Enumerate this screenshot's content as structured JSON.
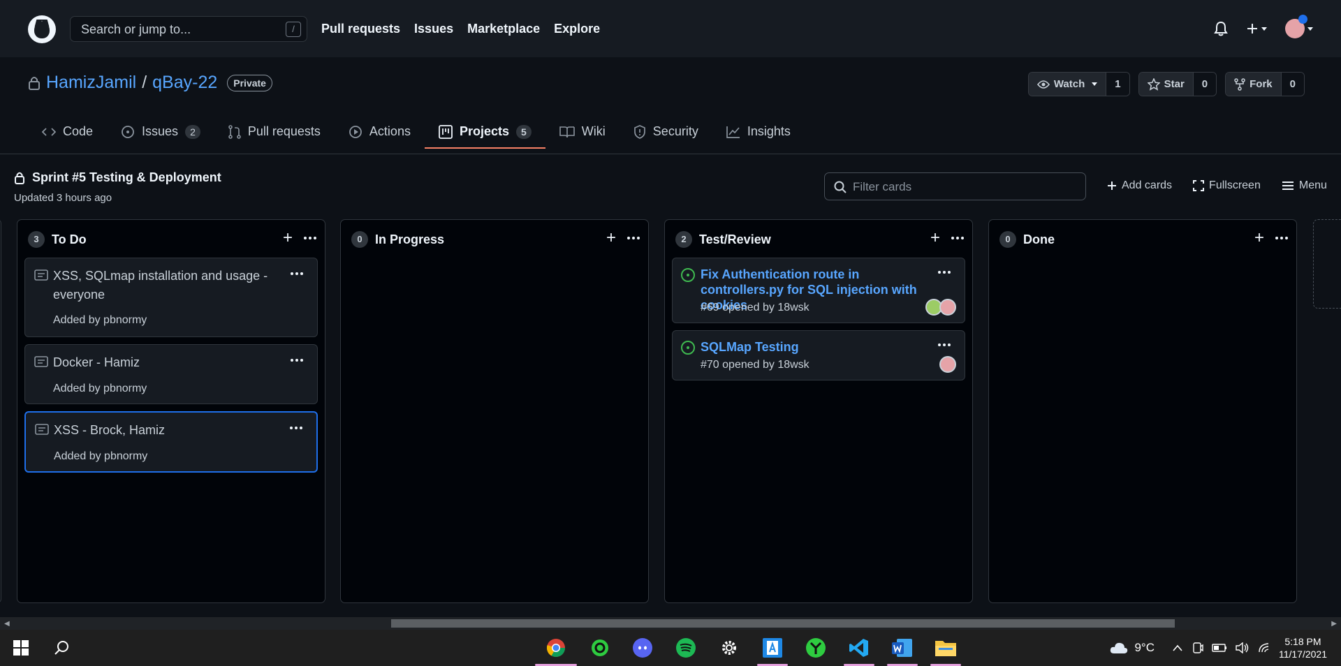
{
  "header": {
    "search_placeholder": "Search or jump to...",
    "search_shortcut": "/",
    "nav": [
      "Pull requests",
      "Issues",
      "Marketplace",
      "Explore"
    ]
  },
  "repo": {
    "owner": "HamizJamil",
    "separator": "/",
    "name": "qBay-22",
    "visibility": "Private",
    "watch_label": "Watch",
    "watch_count": "1",
    "star_label": "Star",
    "star_count": "0",
    "fork_label": "Fork",
    "fork_count": "0"
  },
  "tabs": {
    "code": "Code",
    "issues": "Issues",
    "issues_count": "2",
    "pulls": "Pull requests",
    "actions": "Actions",
    "projects": "Projects",
    "projects_count": "5",
    "wiki": "Wiki",
    "security": "Security",
    "insights": "Insights",
    "selected": "projects"
  },
  "project": {
    "name": "Sprint #5 Testing & Deployment",
    "updated": "Updated 3 hours ago",
    "filter_placeholder": "Filter cards",
    "add_cards": "Add cards",
    "fullscreen": "Fullscreen",
    "menu": "Menu"
  },
  "columns": {
    "todo": {
      "name": "To Do",
      "count": "3",
      "cards": [
        {
          "title": "XSS, SQLmap installation and usage - everyone",
          "meta": "Added by pbnormy"
        },
        {
          "title": "Docker - Hamiz",
          "meta": "Added by pbnormy"
        },
        {
          "title": "XSS - Brock, Hamiz",
          "meta": "Added by pbnormy"
        }
      ]
    },
    "inprogress": {
      "name": "In Progress",
      "count": "0"
    },
    "review": {
      "name": "Test/Review",
      "count": "2",
      "cards": [
        {
          "title": "Fix Authentication route in controllers.py for SQL injection with cookies",
          "meta": "#69 opened by 18wsk"
        },
        {
          "title": "SQLMap Testing",
          "meta": "#70 opened by 18wsk"
        }
      ]
    },
    "done": {
      "name": "Done",
      "count": "0"
    }
  },
  "taskbar": {
    "weather": "9°C",
    "time": "5:18 PM",
    "date": "11/17/2021"
  },
  "colors": {
    "accent": "#58a6ff",
    "selected_tab_underline": "#f78166",
    "focus_border": "#1f6feb",
    "open_issue": "#3fb950"
  }
}
